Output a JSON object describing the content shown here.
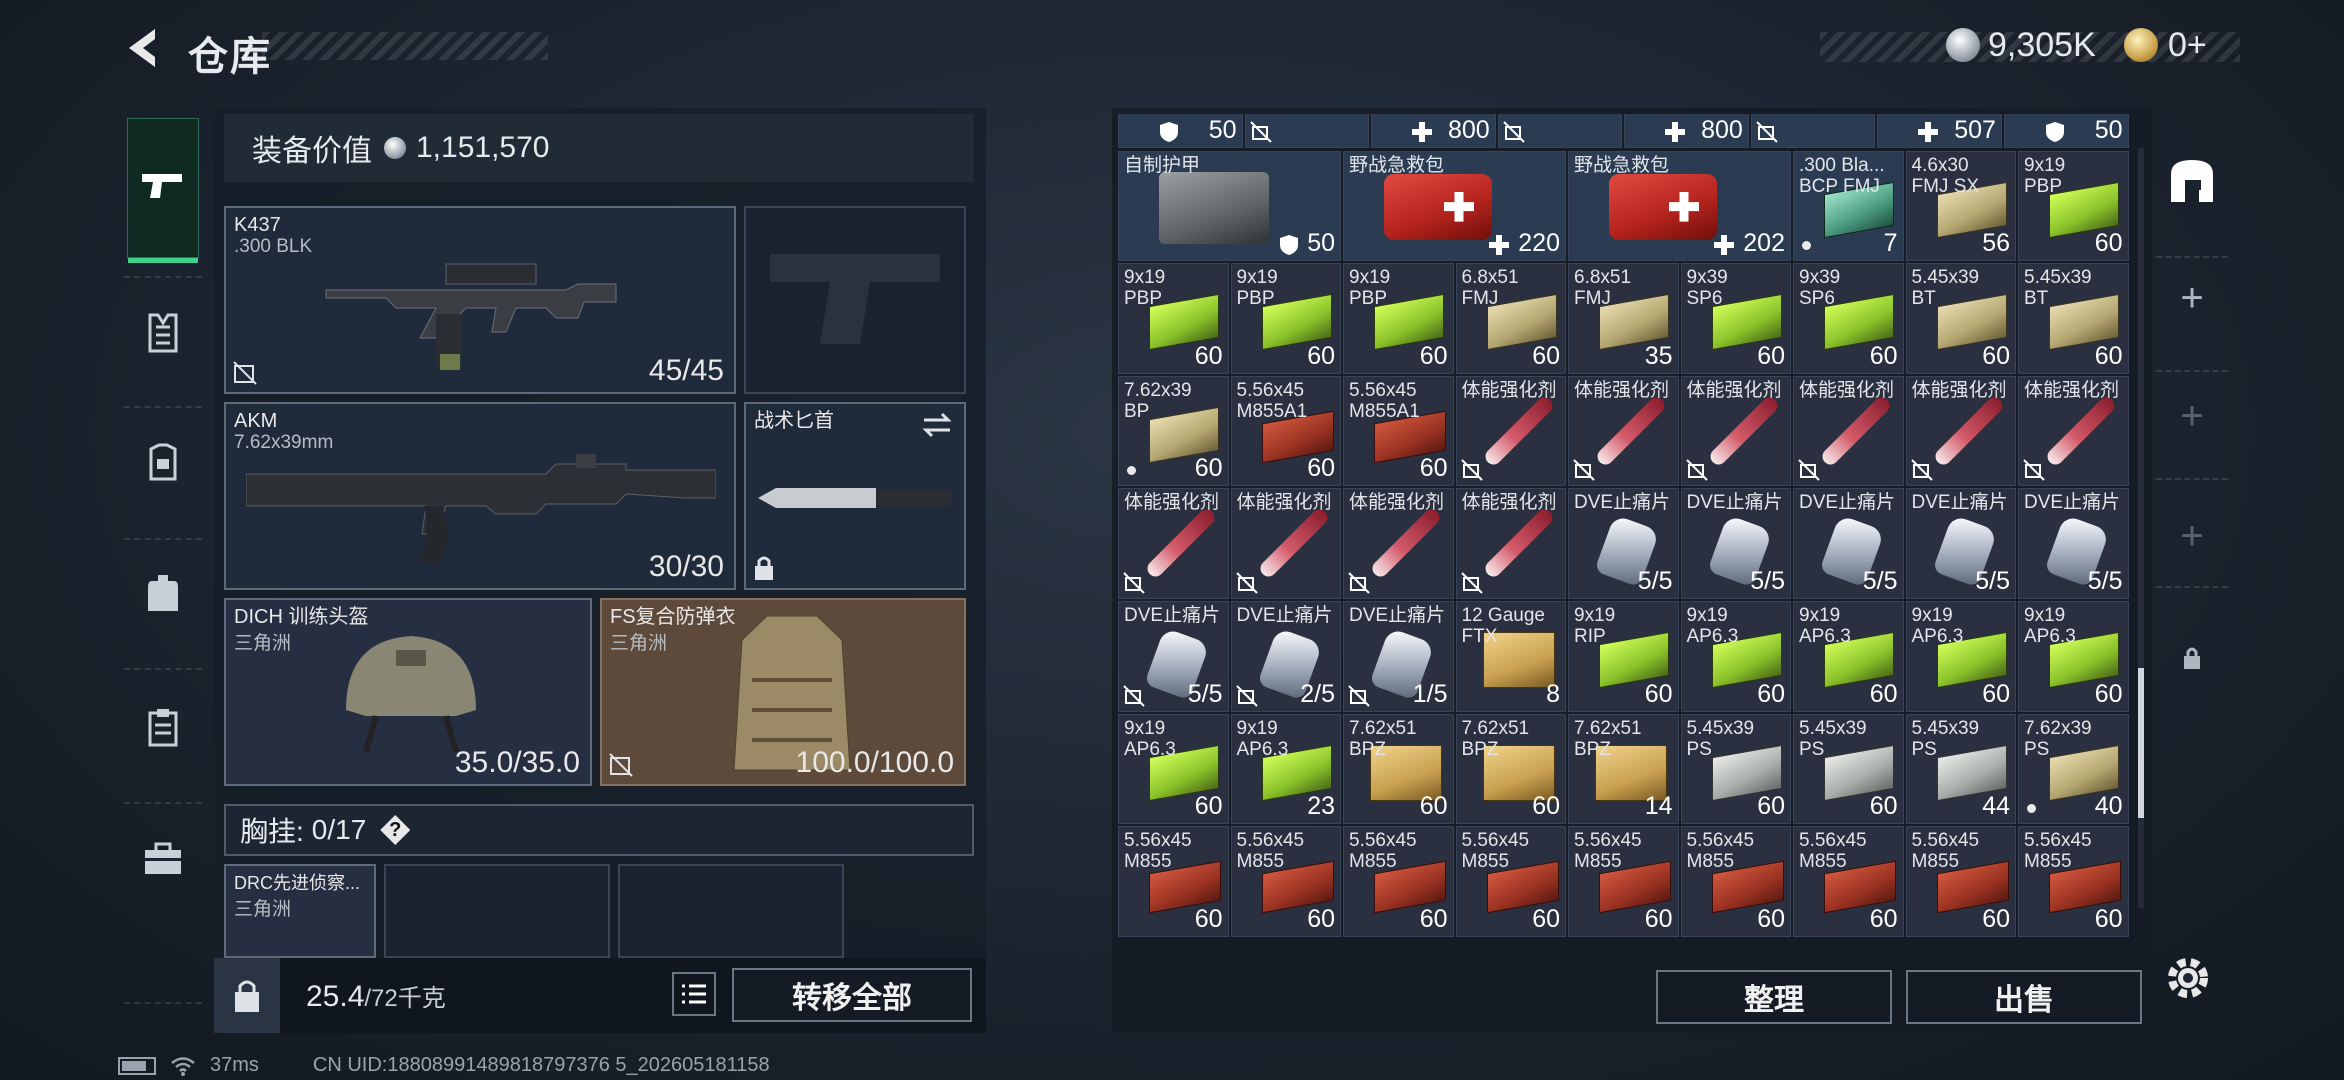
{
  "header": {
    "title": "仓库",
    "currencies": [
      {
        "icon": "silver-coin-icon",
        "value": "9,305K"
      },
      {
        "icon": "gold-coin-icon",
        "value": "0+"
      }
    ]
  },
  "left_nav": [
    "weapon-icon",
    "vest-icon",
    "armor-icon",
    "backpack-icon",
    "clipboard-icon",
    "toolbox-icon"
  ],
  "loadout": {
    "value_label": "装备价值",
    "value": "1,151,570",
    "primary": {
      "name": "K437",
      "sub": ".300 BLK",
      "durability": "45/45"
    },
    "secondary": {
      "name": "AKM",
      "sub": "7.62x39mm",
      "durability": "30/30"
    },
    "knife": {
      "name": "战术匕首"
    },
    "helmet": {
      "name": "DICH 训练头盔",
      "sub": "三角洲",
      "durability": "35.0/35.0"
    },
    "armor": {
      "name": "FS复合防弹衣",
      "sub": "三角洲",
      "durability": "100.0/100.0"
    },
    "chest": {
      "label": "胸挂:",
      "count": "0/17",
      "help": "?"
    },
    "chest_item": {
      "name": "DRC先进侦察...",
      "sub": "三角洲"
    }
  },
  "capacity": {
    "value": "25.4",
    "max": "/72千克"
  },
  "buttons": {
    "transfer_all": "转移全部",
    "sort": "整理",
    "sell": "出售"
  },
  "status": {
    "ping": "37ms",
    "uid": "CN UID:18808991489818797376 5_202605181158"
  },
  "stash": {
    "row0": [
      {
        "q": "50",
        "i": "shield"
      },
      {
        "q": "",
        "i": "nocompare"
      },
      {
        "q": "800",
        "i": "plus"
      },
      {
        "q": "",
        "i": "nocompare"
      },
      {
        "q": "800",
        "i": "plus"
      },
      {
        "q": "",
        "i": "nocompare"
      },
      {
        "q": "507",
        "i": "plus"
      },
      {
        "q": "50",
        "i": "shield"
      }
    ],
    "rows": [
      [
        {
          "n": "自制护甲",
          "q": "50",
          "icon": "shield",
          "type": "armorkit",
          "c": "blue",
          "w": 2
        },
        {
          "n": "野战急救包",
          "q": "220",
          "icon": "plus",
          "type": "medkit",
          "c": "blue",
          "w": 2
        },
        {
          "n": "野战急救包",
          "q": "202",
          "icon": "plus",
          "type": "medkit",
          "c": "blue",
          "w": 2
        },
        {
          "n": ".300 Bla...\nBCP FMJ",
          "q": "7",
          "dot": true,
          "type": "box-teal",
          "c": "blue"
        },
        {
          "n": "4.6x30\nFMJ SX",
          "q": "56",
          "type": "box-tan",
          "c": "ammo"
        },
        {
          "n": "9x19\nPBP",
          "q": "60",
          "type": "box-green",
          "c": "ammo"
        }
      ],
      [
        {
          "n": "9x19\nPBP",
          "q": "60",
          "type": "box-green"
        },
        {
          "n": "9x19\nPBP",
          "q": "60",
          "type": "box-green"
        },
        {
          "n": "9x19\nPBP",
          "q": "60",
          "type": "box-green"
        },
        {
          "n": "6.8x51\nFMJ",
          "q": "60",
          "type": "box-tan"
        },
        {
          "n": "6.8x51\nFMJ",
          "q": "35",
          "type": "box-tan"
        },
        {
          "n": "9x39\nSP6",
          "q": "60",
          "type": "box-green"
        },
        {
          "n": "9x39\nSP6",
          "q": "60",
          "type": "box-green"
        },
        {
          "n": "5.45x39\nBT",
          "q": "60",
          "type": "box-tan"
        },
        {
          "n": "5.45x39\nBT",
          "q": "60",
          "type": "box-tan"
        }
      ],
      [
        {
          "n": "7.62x39\nBP",
          "q": "60",
          "dot": true,
          "type": "box-tan"
        },
        {
          "n": "5.56x45\nM855A1",
          "q": "60",
          "type": "box-red"
        },
        {
          "n": "5.56x45\nM855A1",
          "q": "60",
          "type": "box-red"
        },
        {
          "n": "体能强化剂",
          "q": "",
          "icon": "nocompare",
          "type": "syr"
        },
        {
          "n": "体能强化剂",
          "q": "",
          "icon": "nocompare",
          "type": "syr"
        },
        {
          "n": "体能强化剂",
          "q": "",
          "icon": "nocompare",
          "type": "syr"
        },
        {
          "n": "体能强化剂",
          "q": "",
          "icon": "nocompare",
          "type": "syr"
        },
        {
          "n": "体能强化剂",
          "q": "",
          "icon": "nocompare",
          "type": "syr"
        },
        {
          "n": "体能强化剂",
          "q": "",
          "icon": "nocompare",
          "type": "syr"
        }
      ],
      [
        {
          "n": "体能强化剂",
          "q": "",
          "icon": "nocompare",
          "type": "syr"
        },
        {
          "n": "体能强化剂",
          "q": "",
          "icon": "nocompare",
          "type": "syr"
        },
        {
          "n": "体能强化剂",
          "q": "",
          "icon": "nocompare",
          "type": "syr"
        },
        {
          "n": "体能强化剂",
          "q": "",
          "icon": "nocompare",
          "type": "syr"
        },
        {
          "n": "DVE止痛片",
          "q": "5/5",
          "type": "pill"
        },
        {
          "n": "DVE止痛片",
          "q": "5/5",
          "type": "pill"
        },
        {
          "n": "DVE止痛片",
          "q": "5/5",
          "type": "pill"
        },
        {
          "n": "DVE止痛片",
          "q": "5/5",
          "type": "pill"
        },
        {
          "n": "DVE止痛片",
          "q": "5/5",
          "type": "pill"
        }
      ],
      [
        {
          "n": "DVE止痛片",
          "q": "5/5",
          "icon": "nocompare",
          "type": "pill"
        },
        {
          "n": "DVE止痛片",
          "q": "2/5",
          "icon": "nocompare",
          "type": "pill"
        },
        {
          "n": "DVE止痛片",
          "q": "1/5",
          "icon": "nocompare",
          "type": "pill"
        },
        {
          "n": "12 Gauge\nFTX",
          "q": "8",
          "type": "box-wood"
        },
        {
          "n": "9x19\nRIP",
          "q": "60",
          "type": "box-green"
        },
        {
          "n": "9x19\nAP6.3",
          "q": "60",
          "type": "box-green"
        },
        {
          "n": "9x19\nAP6.3",
          "q": "60",
          "type": "box-green"
        },
        {
          "n": "9x19\nAP6.3",
          "q": "60",
          "type": "box-green"
        },
        {
          "n": "9x19\nAP6.3",
          "q": "60",
          "type": "box-green"
        }
      ],
      [
        {
          "n": "9x19\nAP6.3",
          "q": "60",
          "type": "box-green"
        },
        {
          "n": "9x19\nAP6.3",
          "q": "23",
          "type": "box-green"
        },
        {
          "n": "7.62x51\nBPZ",
          "q": "60",
          "type": "box-wood"
        },
        {
          "n": "7.62x51\nBPZ",
          "q": "60",
          "type": "box-wood"
        },
        {
          "n": "7.62x51\nBPZ",
          "q": "14",
          "type": "box-wood"
        },
        {
          "n": "5.45x39\nPS",
          "q": "60",
          "type": "box-grey"
        },
        {
          "n": "5.45x39\nPS",
          "q": "60",
          "type": "box-grey"
        },
        {
          "n": "5.45x39\nPS",
          "q": "44",
          "type": "box-grey"
        },
        {
          "n": "7.62x39\nPS",
          "q": "40",
          "dot": true,
          "type": "box-tan"
        }
      ],
      [
        {
          "n": "5.56x45\nM855",
          "q": "60",
          "type": "box-red"
        },
        {
          "n": "5.56x45\nM855",
          "q": "60",
          "type": "box-red"
        },
        {
          "n": "5.56x45\nM855",
          "q": "60",
          "type": "box-red"
        },
        {
          "n": "5.56x45\nM855",
          "q": "60",
          "type": "box-red"
        },
        {
          "n": "5.56x45\nM855",
          "q": "60",
          "type": "box-red"
        },
        {
          "n": "5.56x45\nM855",
          "q": "60",
          "type": "box-red"
        },
        {
          "n": "5.56x45\nM855",
          "q": "60",
          "type": "box-red"
        },
        {
          "n": "5.56x45\nM855",
          "q": "60",
          "type": "box-red"
        },
        {
          "n": "5.56x45\nM855",
          "q": "60",
          "type": "box-red"
        }
      ]
    ]
  }
}
